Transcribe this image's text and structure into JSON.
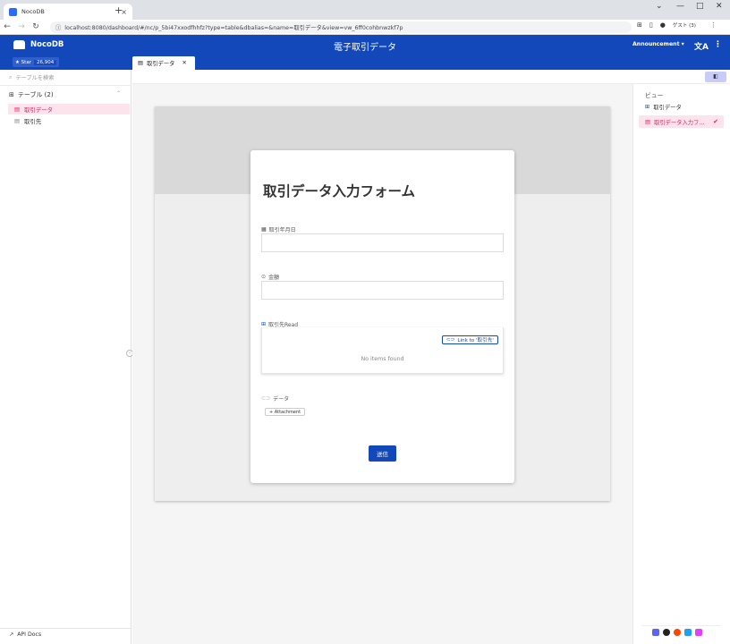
{
  "browser": {
    "tab_title": "NocoDB",
    "tab_close": "×",
    "new_tab": "+",
    "url": "localhost:8080/dashboard/#/nc/p_5bi47xxodfhhfz?type=table&dbalias=&name=取引データ&view=vw_6ff0cohbnwzkf7p",
    "profile_label": "ゲスト (3)",
    "window_min": "⌄",
    "window_minimize": "—",
    "window_max": "□",
    "window_close": "✕"
  },
  "header": {
    "brand": "NocoDB",
    "title": "電子取引データ",
    "announcement": "Announcement ▾",
    "translate_icon": "文A",
    "menu_icon": "⋮",
    "star_label": "★ Star",
    "star_count": "26,904"
  },
  "tabs": [
    {
      "label": "取引データ",
      "close": "✕"
    }
  ],
  "sidebar": {
    "search_placeholder": "テーブルを検索",
    "tables_header": "テーブル (2)",
    "tables": [
      {
        "label": "取引データ",
        "active": true
      },
      {
        "label": "取引先",
        "active": false
      }
    ],
    "api_docs": "API Docs"
  },
  "form": {
    "title": "取引データ入力フォーム",
    "fields": [
      {
        "label": "取引年月日",
        "icon": "calendar-icon"
      },
      {
        "label": "金額",
        "icon": "currency-icon"
      },
      {
        "label": "取引先Read",
        "icon": "link-icon"
      },
      {
        "label": "データ",
        "icon": "attachment-icon"
      }
    ],
    "link_button": "Link to '取引先'",
    "no_items": "No items found",
    "attachment_button": "+ Attachment",
    "submit": "送信"
  },
  "views": {
    "header": "ビュー",
    "items": [
      {
        "label": "取引データ",
        "active": false
      },
      {
        "label": "取引データ入力フ...",
        "active": true
      }
    ]
  },
  "colors": {
    "primary": "#1348ba",
    "accent_pink": "#e0245e",
    "active_bg": "#fde4ec"
  }
}
